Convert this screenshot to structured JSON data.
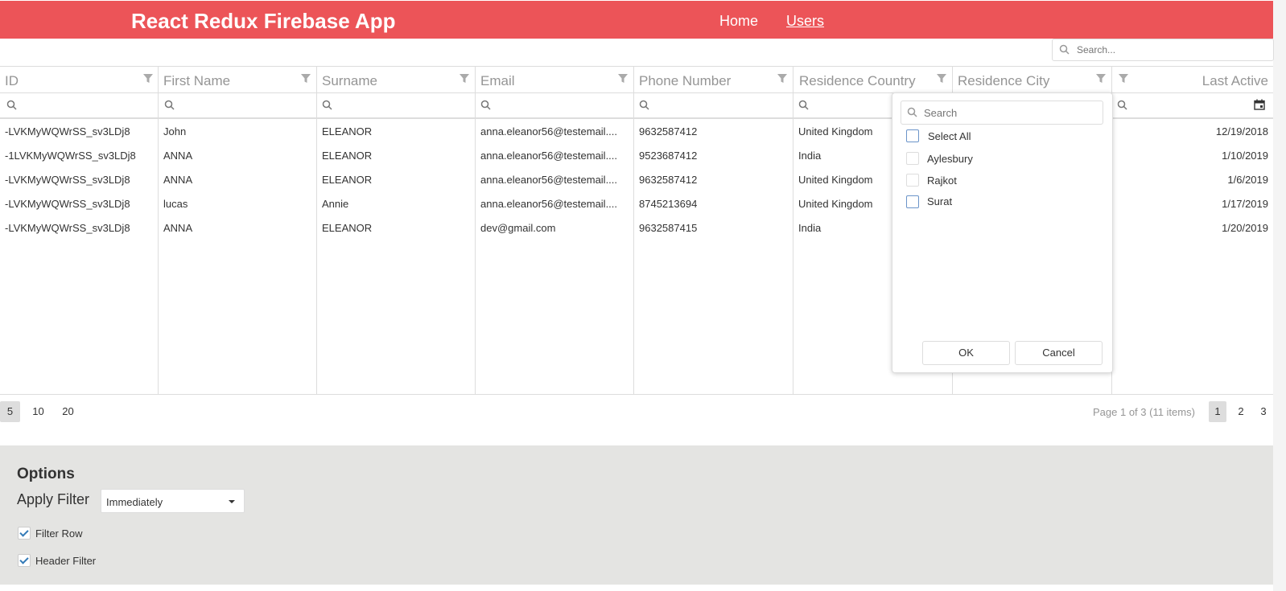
{
  "app": {
    "title": "React Redux Firebase App"
  },
  "nav": {
    "home": "Home",
    "users": "Users"
  },
  "grid": {
    "search_placeholder": "Search...",
    "columns": [
      "ID",
      "First Name",
      "Surname",
      "Email",
      "Phone Number",
      "Residence Country",
      "Residence City",
      "Last Active"
    ],
    "rows": [
      [
        "-LVKMyWQWrSS_sv3LDj8",
        "John",
        "ELEANOR",
        "anna.eleanor56@testemail....",
        "9632587412",
        "United Kingdom",
        "",
        "12/19/2018"
      ],
      [
        "-1LVKMyWQWrSS_sv3LDj8",
        "ANNA",
        "ELEANOR",
        "anna.eleanor56@testemail....",
        "9523687412",
        "India",
        "",
        "1/10/2019"
      ],
      [
        "-LVKMyWQWrSS_sv3LDj8",
        "ANNA",
        "ELEANOR",
        "anna.eleanor56@testemail....",
        "9632587412",
        "United Kingdom",
        "",
        "1/6/2019"
      ],
      [
        "-LVKMyWQWrSS_sv3LDj8",
        "lucas",
        "Annie",
        "anna.eleanor56@testemail....",
        "8745213694",
        "United Kingdom",
        "",
        "1/17/2019"
      ],
      [
        "-LVKMyWQWrSS_sv3LDj8",
        "ANNA",
        "ELEANOR",
        "dev@gmail.com",
        "9632587415",
        "India",
        "",
        "1/20/2019"
      ]
    ]
  },
  "pager": {
    "sizes": [
      "5",
      "10",
      "20"
    ],
    "info": "Page 1 of 3 (11 items)",
    "pages": [
      "1",
      "2",
      "3"
    ]
  },
  "options": {
    "title": "Options",
    "apply_filter_label": "Apply Filter",
    "apply_filter_value": "Immediately",
    "filter_row_label": "Filter Row",
    "header_filter_label": "Header Filter"
  },
  "header_filter_popup": {
    "search_placeholder": "Search",
    "items": [
      "Select All",
      "Aylesbury",
      "Rajkot",
      "Surat"
    ],
    "ok": "OK",
    "cancel": "Cancel"
  },
  "colors": {
    "navbar": "#ec5458",
    "options_bg": "#e4e4e2",
    "accent": "#337ab7"
  },
  "icons": [
    "search-icon",
    "filter-icon",
    "calendar-icon",
    "check-icon",
    "caret-down-icon"
  ]
}
